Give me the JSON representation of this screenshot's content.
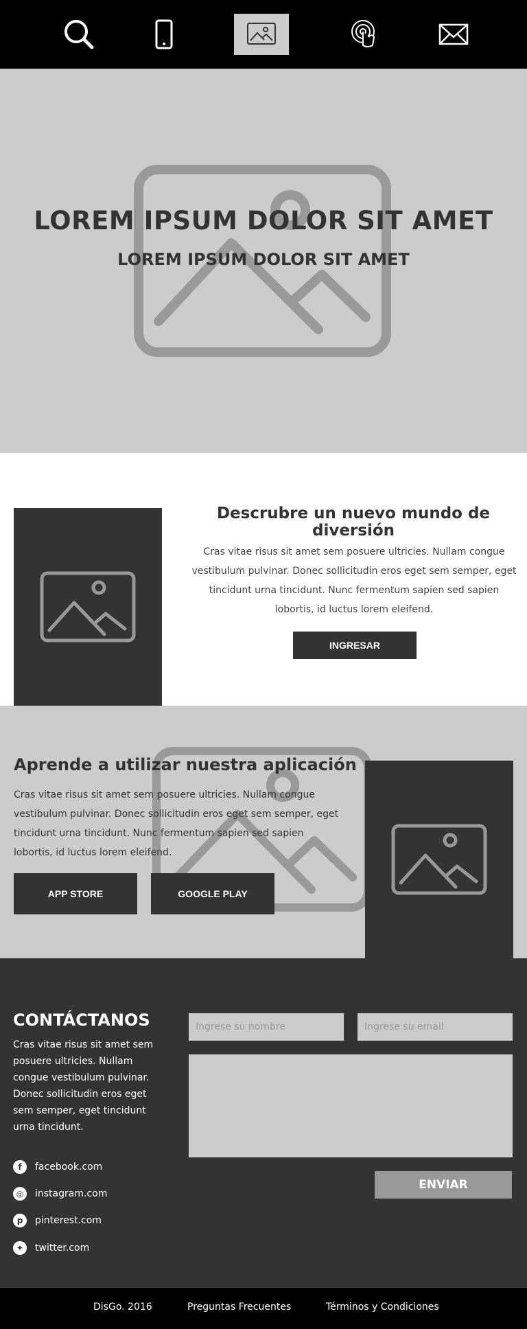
{
  "nav": {
    "items": [
      {
        "icon": "search-icon"
      },
      {
        "icon": "smartphone-icon"
      },
      {
        "icon": "image-icon",
        "active": true
      },
      {
        "icon": "touch-icon"
      },
      {
        "icon": "mail-icon"
      }
    ]
  },
  "hero": {
    "title": "LOREM IPSUM DOLOR SIT AMET",
    "subtitle": "LOREM IPSUM DOLOR SIT AMET",
    "background_icon": "image-placeholder-icon"
  },
  "discover": {
    "title": "Descrubre un nuevo mundo de diversión",
    "text": "Cras vitae risus sit amet sem posuere ultricies. Nullam congue vestibulum pulvinar. Donec sollicitudin eros eget sem semper, eget tincidunt urna tincidunt. Nunc fermentum sapien sed sapien lobortis, id luctus lorem eleifend.",
    "button_label": "INGRESAR"
  },
  "app": {
    "title": "Aprende a utilizar nuestra aplicación",
    "text": "Cras vitae risus sit amet sem posuere ultricies. Nullam congue vestibulum pulvinar. Donec sollicitudin eros eget sem semper, eget tincidunt urna tincidunt. Nunc fermentum sapien sed sapien lobortis, id luctus lorem eleifend.",
    "appstore_label": "APP STORE",
    "googleplay_label": "GOOGLE PLAY"
  },
  "contact": {
    "title": "CONTÁCTANOS",
    "text": "Cras vitae risus sit amet sem posuere ultricies. Nullam congue vestibulum pulvinar. Donec sollicitudin eros eget sem semper, eget tincidunt urna tincidunt.",
    "social": [
      {
        "icon": "facebook-icon",
        "glyph": "f",
        "label": "facebook.com"
      },
      {
        "icon": "instagram-icon",
        "glyph": "◎",
        "label": "instagram.com"
      },
      {
        "icon": "pinterest-icon",
        "glyph": "p",
        "label": "pinterest.com"
      },
      {
        "icon": "twitter-icon",
        "glyph": "✦",
        "label": "twitter.com"
      }
    ],
    "name_placeholder": "Ingrese su nombre",
    "email_placeholder": "Ingrese su email",
    "message_value": "",
    "send_label": "ENVIAR"
  },
  "footer": {
    "items": [
      "DisGo. 2016",
      "Preguntas Frecuentes",
      "Términos y Condiciones"
    ]
  },
  "colors": {
    "black": "#000000",
    "dark": "#333333",
    "light_gray": "#cccccc",
    "mid_gray": "#999999",
    "white": "#ffffff"
  }
}
